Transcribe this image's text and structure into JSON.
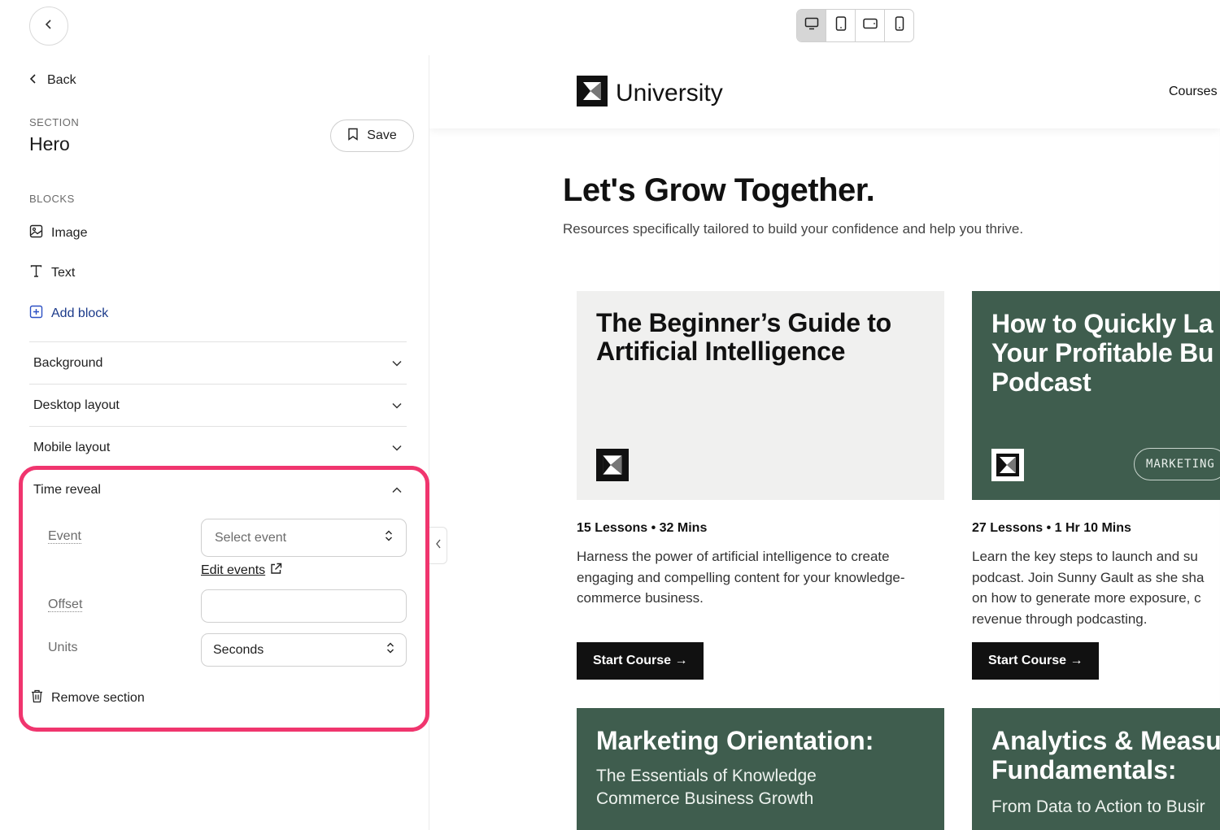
{
  "toolbar": {
    "devices": [
      "desktop-icon",
      "tablet-icon",
      "tablet-landscape-icon",
      "mobile-icon"
    ],
    "active_device": "desktop"
  },
  "sidebar": {
    "back_label": "Back",
    "section_kicker": "SECTION",
    "section_title": "Hero",
    "save_label": "Save",
    "blocks_kicker": "BLOCKS",
    "blocks": [
      {
        "label": "Image",
        "icon": "image-icon"
      },
      {
        "label": "Text",
        "icon": "text-icon"
      }
    ],
    "add_block_label": "Add block",
    "accordions": [
      {
        "label": "Background"
      },
      {
        "label": "Desktop layout"
      },
      {
        "label": "Mobile layout"
      }
    ],
    "time_reveal": {
      "label": "Time reveal",
      "event_label": "Event",
      "event_placeholder": "Select event",
      "edit_events_label": "Edit events",
      "offset_label": "Offset",
      "offset_value": "",
      "units_label": "Units",
      "units_value": "Seconds"
    },
    "remove_section_label": "Remove section"
  },
  "preview": {
    "brand": "University",
    "nav_courses": "Courses",
    "hero_title": "Let's Grow Together.",
    "hero_subtitle": "Resources specifically tailored to build your confidence and help you thrive.",
    "courses": [
      {
        "title_line1": "The Beginner’s Guide to",
        "title_line2": "Artificial Intelligence",
        "meta": "15 Lessons • 32 Mins",
        "description": "Harness the power of artificial intelligence to create engaging and compelling content for your knowledge-commerce business.",
        "cta": "Start Course →"
      },
      {
        "title_line1": "How to Quickly La",
        "title_line2": "Your Profitable Bu",
        "title_line3": "Podcast",
        "tag": "MARKETING",
        "meta": "27 Lessons • 1 Hr 10 Mins",
        "description_line1": "Learn the key steps to launch and su",
        "description_line2": "podcast. Join Sunny Gault as she sha",
        "description_line3": "on how to generate more exposure, c",
        "description_line4": "revenue through podcasting.",
        "cta": "Start Course →"
      }
    ],
    "lower_cards": [
      {
        "title": "Marketing Orientation:",
        "subtitle_line1": "The Essentials of Knowledge",
        "subtitle_line2": "Commerce Business Growth"
      },
      {
        "title_line1": "Analytics & Measu",
        "title_line2": "Fundamentals:",
        "subtitle_line1": "From Data to Action to Busir"
      }
    ]
  }
}
